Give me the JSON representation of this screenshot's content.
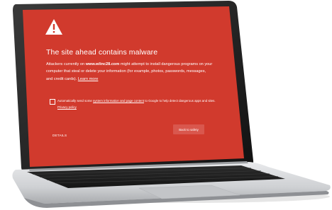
{
  "warning": {
    "icon": "warning-triangle-icon",
    "headline": "The site ahead contains malware",
    "body_prefix": "Attackers currently on ",
    "site": "www.wlinc28.com",
    "body_suffix": " might attempt to install dangerous programs on your computer that steal or delete your information (for example, photos, passwords, messages, and credit cards). ",
    "learn_more": "Learn more",
    "checkbox": {
      "text_prefix": "Automatically send some ",
      "link1": "system information and page content",
      "text_mid": " to Google to help detect dangerous apps and sites. ",
      "link2": "Privacy policy",
      "checked": false
    },
    "details_label": "DETAILS",
    "back_label": "Back to safety"
  },
  "colors": {
    "screen_red": "#d13a2d",
    "button_red": "#d9574d",
    "text": "#ffffff"
  }
}
